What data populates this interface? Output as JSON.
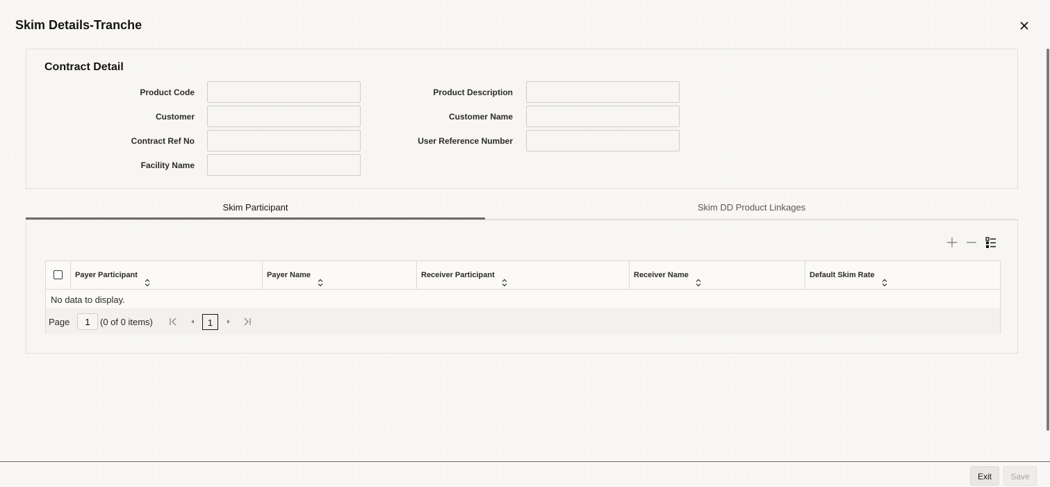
{
  "window": {
    "title": "Skim Details-Tranche",
    "close_icon": "close-icon"
  },
  "contract_detail": {
    "heading": "Contract Detail",
    "fields": {
      "product_code": {
        "label": "Product Code",
        "value": ""
      },
      "product_description": {
        "label": "Product Description",
        "value": ""
      },
      "customer": {
        "label": "Customer",
        "value": ""
      },
      "customer_name": {
        "label": "Customer Name",
        "value": ""
      },
      "contract_ref_no": {
        "label": "Contract Ref No",
        "value": ""
      },
      "user_reference_number": {
        "label": "User Reference Number",
        "value": ""
      },
      "facility_name": {
        "label": "Facility Name",
        "value": ""
      }
    }
  },
  "tabs": [
    {
      "label": "Skim Participant",
      "active": true
    },
    {
      "label": "Skim DD Product Linkages",
      "active": false
    }
  ],
  "grid": {
    "toolbar": {
      "add_icon": "plus-icon",
      "remove_icon": "minus-icon",
      "columns_icon": "list-icon"
    },
    "columns": [
      "Payer Participant",
      "Payer Name",
      "Receiver Participant",
      "Receiver Name",
      "Default Skim Rate"
    ],
    "rows": [],
    "empty_text": "No data to display."
  },
  "pagination": {
    "page_label": "Page",
    "page_value": "1",
    "items_text": "(0 of 0 items)",
    "current_page": "1"
  },
  "footer": {
    "exit_label": "Exit",
    "save_label": "Save"
  }
}
